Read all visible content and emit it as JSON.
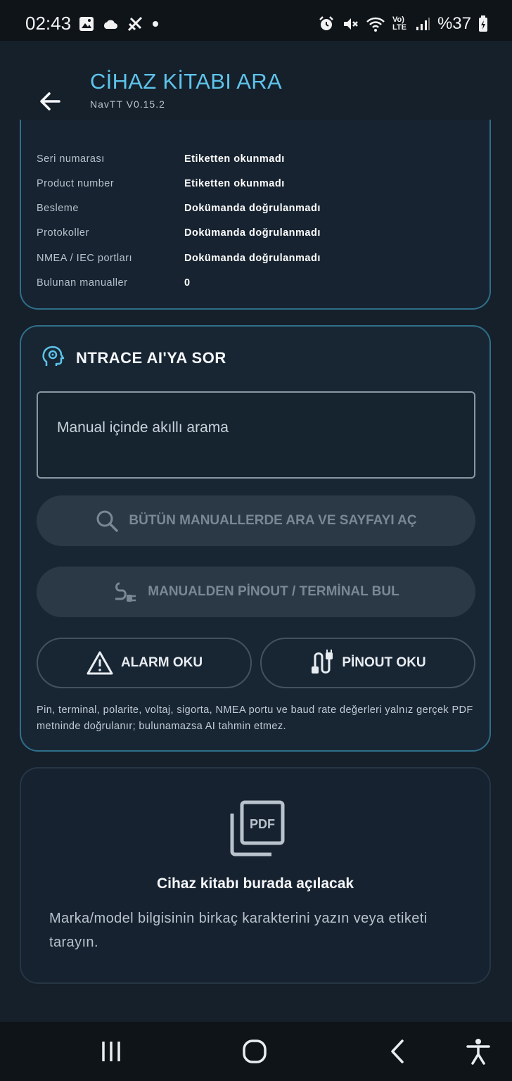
{
  "status": {
    "time": "02:43",
    "battery": "%37",
    "network_label": "Vo) LTE"
  },
  "header": {
    "title": "CİHAZ KİTABI ARA",
    "version": "NavTT V0.15.2"
  },
  "info": {
    "rows": [
      {
        "label": "Seri numarası",
        "value": "Etiketten okunmadı"
      },
      {
        "label": "Product number",
        "value": "Etiketten okunmadı"
      },
      {
        "label": "Besleme",
        "value": "Dokümanda doğrulanmadı"
      },
      {
        "label": "Protokoller",
        "value": "Dokümanda doğrulanmadı"
      },
      {
        "label": "NMEA / IEC portları",
        "value": "Dokümanda doğrulanmadı"
      },
      {
        "label": "Bulunan manualler",
        "value": "0"
      }
    ]
  },
  "ai": {
    "title": "NTRACE AI'YA SOR",
    "input_placeholder": "Manual içinde akıllı arama",
    "search_all_label": "BÜTÜN MANUALLERDE ARA VE SAYFAYI AÇ",
    "pinout_find_label": "MANUALDEN PİNOUT / TERMİNAL BUL",
    "alarm_label": "ALARM OKU",
    "pinout_read_label": "PİNOUT OKU",
    "note": "Pin, terminal, polarite, voltaj, sigorta, NMEA portu ve baud rate değerleri yalnız gerçek PDF metninde doğrulanır; bulunamazsa AI tahmin etmez."
  },
  "pdf": {
    "icon_text": "PDF",
    "title": "Cihaz kitabı burada açılacak",
    "description": "Marka/model bilgisinin birkaç karakterini yazın veya etiketi tarayın."
  },
  "colors": {
    "accent": "#5ec3ea",
    "background": "#15202b",
    "card_border": "#2f6f8a"
  }
}
